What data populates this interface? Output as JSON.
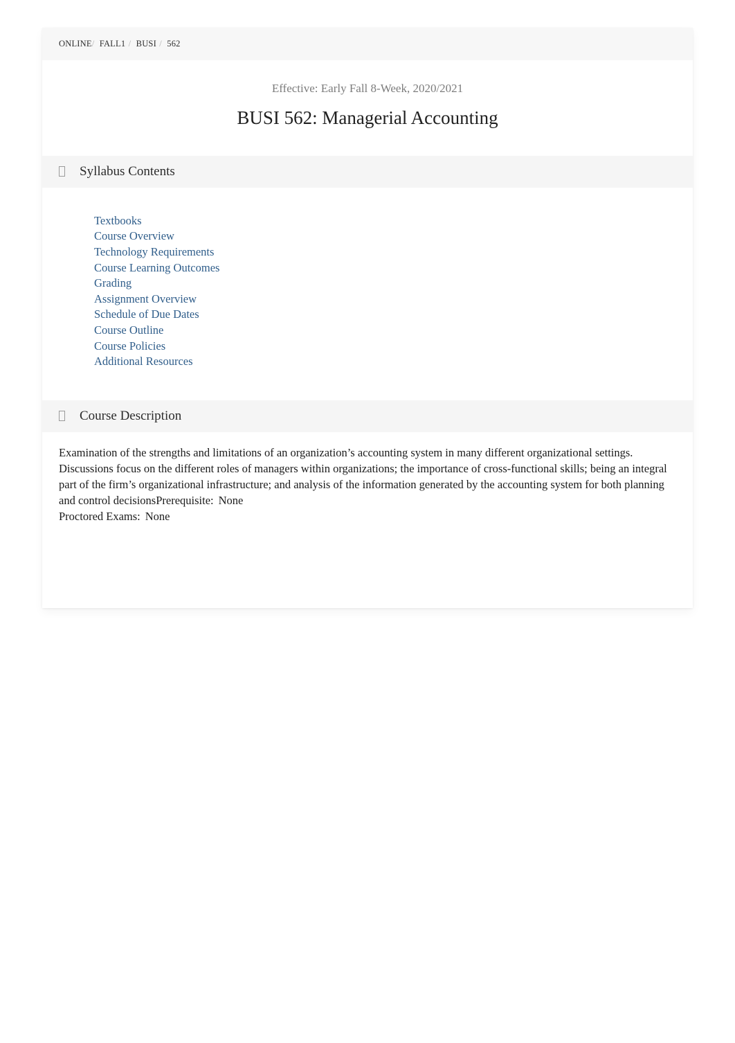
{
  "breadcrumb": {
    "items": [
      "ONLINE",
      "FALL1",
      "BUSI",
      "562"
    ],
    "separator": "/"
  },
  "header": {
    "effective": "Effective: Early Fall 8-Week, 2020/2021",
    "title": "BUSI 562: Managerial Accounting"
  },
  "sections": {
    "syllabus_contents": {
      "icon": "missing-glyph-box-icon",
      "title": "Syllabus Contents",
      "links": [
        "Textbooks",
        "Course Overview",
        "Technology Requirements",
        "Course Learning Outcomes",
        "Grading",
        "Assignment Overview",
        "Schedule of Due Dates",
        "Course Outline",
        "Course Policies",
        "Additional Resources"
      ]
    },
    "course_description": {
      "icon": "missing-glyph-box-icon",
      "title": "Course Description",
      "body": "Examination of the strengths and limitations of an organization’s accounting system in many different organizational settings. Discussions focus on the different roles of managers within organizations; the importance of cross-functional skills; being an integral part of the firm’s organizational infrastructure; and analysis of the information generated by the accounting system for both planning and control decisions",
      "prerequisite_label": "Prerequisite:",
      "prerequisite_value": "None",
      "proctored_label": "Proctored Exams:",
      "proctored_value": "None"
    }
  },
  "colors": {
    "link": "#2f5d8a",
    "band": "#f5f5f5",
    "breadcrumb_band": "#f7f7f7",
    "muted_text": "#7c7c7c",
    "body_text": "#1c1c1c"
  }
}
